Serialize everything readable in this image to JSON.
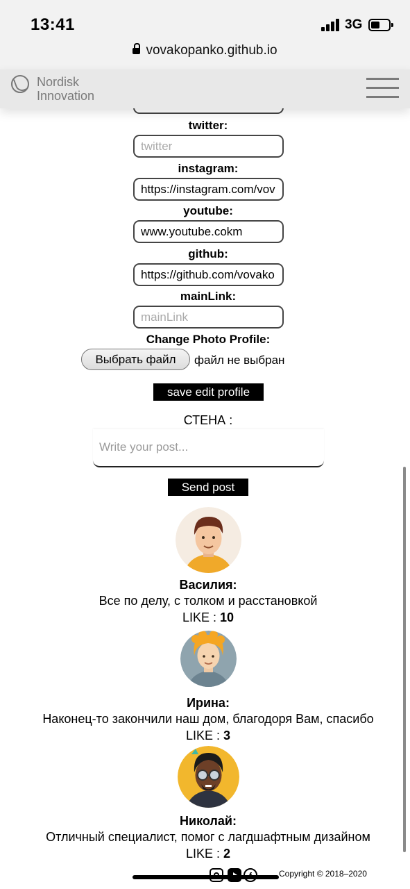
{
  "status_bar": {
    "time": "13:41",
    "network": "3G",
    "url": "vovakopanko.github.io"
  },
  "header": {
    "logo_line1": "Nordisk",
    "logo_line2": "Innovation",
    "menu_icon": "hamburger-menu-icon"
  },
  "form": {
    "twitter_label": "twitter:",
    "twitter_placeholder": "twitter",
    "instagram_label": "instagram:",
    "instagram_value": "https://instagram.com/vov",
    "youtube_label": "youtube:",
    "youtube_value": "www.youtube.cokm",
    "github_label": "github:",
    "github_value": "https://github.com/vovako",
    "mainlink_label": "mainLink:",
    "mainlink_placeholder": "mainLink",
    "photo_label": "Change Photo Profile:",
    "choose_file_label": "Выбрать файл",
    "no_file_text": "файл не выбран",
    "save_label": "save edit profile"
  },
  "wall": {
    "title": "СТЕНА :",
    "post_placeholder": "Write your post...",
    "send_label": "Send post"
  },
  "reviews": [
    {
      "name": "Василия:",
      "text": "Все по делу, с толком и расстановкой",
      "like_label": "LIKE :",
      "likes": "10"
    },
    {
      "name": "Ирина:",
      "text": "Наконец-то закончили наш дом, благодоря Вам, спасибо",
      "like_label": "LIKE :",
      "likes": "3"
    },
    {
      "name": "Николай:",
      "text": "Отличный специалист, помог с лагдшафтным дизайном",
      "like_label": "LIKE :",
      "likes": "2"
    }
  ],
  "footer": {
    "copyright": "Copyright © 2018–2020",
    "icons": [
      "instagram-icon",
      "youtube-icon",
      "facebook-icon"
    ]
  }
}
